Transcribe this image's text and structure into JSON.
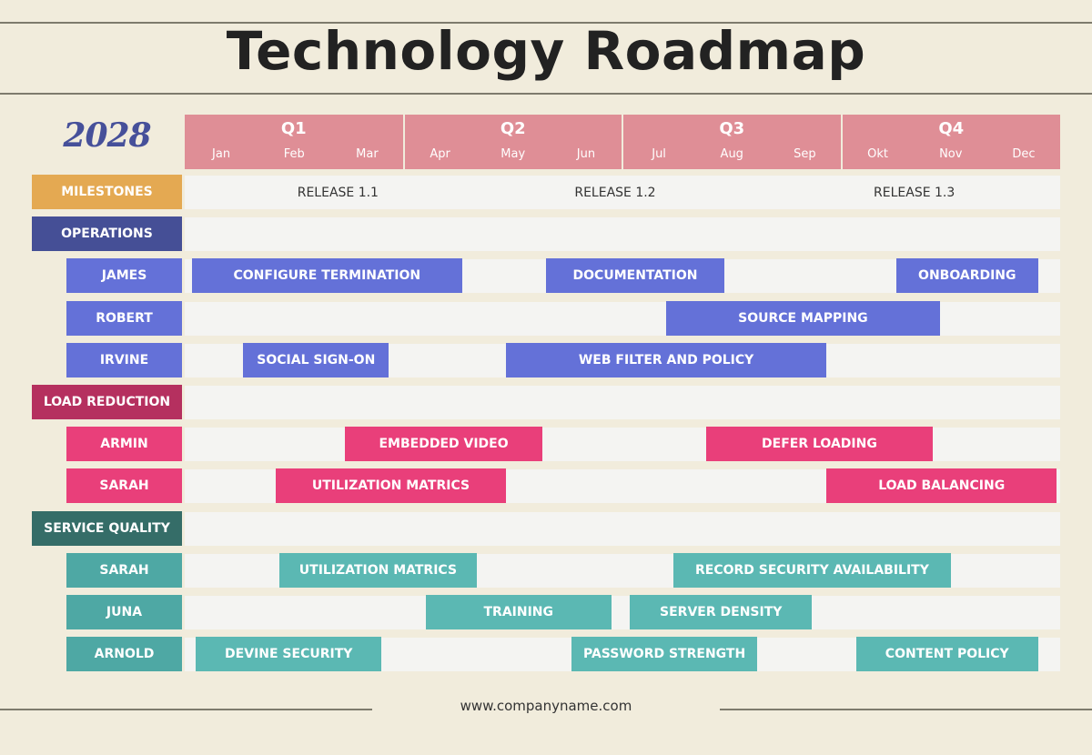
{
  "title": "Technology Roadmap",
  "footer": "www.companyname.com",
  "chart_data": {
    "type": "gantt",
    "title": "Technology Roadmap",
    "year": "2028",
    "quarters": [
      "Q1",
      "Q2",
      "Q3",
      "Q4"
    ],
    "months": [
      "Jan",
      "Feb",
      "Mar",
      "Apr",
      "May",
      "Jun",
      "Jul",
      "Aug",
      "Sep",
      "Okt",
      "Nov",
      "Dec"
    ],
    "milestones": {
      "label": "MILESTONES",
      "color": "#e4a952",
      "items": [
        {
          "label": "RELEASE 1.1",
          "month": 2.1
        },
        {
          "label": "RELEASE 1.2",
          "month": 5.9
        },
        {
          "label": "RELEASE 1.3",
          "month": 10.0
        }
      ]
    },
    "groups": [
      {
        "label": "OPERATIONS",
        "header_color": "#454f96",
        "bar_color": "#6471d8",
        "rows": [
          {
            "name": "JAMES",
            "tasks": [
              {
                "label": "CONFIGURE TERMINATION",
                "start": 0.1,
                "end": 3.8
              },
              {
                "label": "DOCUMENTATION",
                "start": 4.95,
                "end": 7.4
              },
              {
                "label": "ONBOARDING",
                "start": 9.75,
                "end": 11.7
              }
            ]
          },
          {
            "name": "ROBERT",
            "tasks": [
              {
                "label": "SOURCE MAPPING",
                "start": 6.6,
                "end": 10.35
              }
            ]
          },
          {
            "name": "IRVINE",
            "tasks": [
              {
                "label": "SOCIAL SIGN-ON",
                "start": 0.8,
                "end": 2.8
              },
              {
                "label": "WEB FILTER AND POLICY",
                "start": 4.4,
                "end": 8.8
              }
            ]
          }
        ]
      },
      {
        "label": "LOAD REDUCTION",
        "header_color": "#b5305f",
        "bar_color": "#e93f7a",
        "rows": [
          {
            "name": "ARMIN",
            "tasks": [
              {
                "label": "EMBEDDED VIDEO",
                "start": 2.2,
                "end": 4.9
              },
              {
                "label": "DEFER LOADING",
                "start": 7.15,
                "end": 10.25
              }
            ]
          },
          {
            "name": "SARAH",
            "tasks": [
              {
                "label": "UTILIZATION MATRICS",
                "start": 1.25,
                "end": 4.4
              },
              {
                "label": "LOAD BALANCING",
                "start": 8.8,
                "end": 11.95
              }
            ]
          }
        ]
      },
      {
        "label": "SERVICE QUALITY",
        "header_color": "#356d68",
        "bar_color": "#5bb8b3",
        "label_color": "#4ea8a4",
        "rows": [
          {
            "name": "SARAH",
            "tasks": [
              {
                "label": "UTILIZATION MATRICS",
                "start": 1.3,
                "end": 4.0
              },
              {
                "label": "RECORD SECURITY AVAILABILITY",
                "start": 6.7,
                "end": 10.5
              }
            ]
          },
          {
            "name": "JUNA",
            "tasks": [
              {
                "label": "TRAINING",
                "start": 3.3,
                "end": 5.85
              },
              {
                "label": "SERVER DENSITY",
                "start": 6.1,
                "end": 8.6
              }
            ]
          },
          {
            "name": "ARNOLD",
            "tasks": [
              {
                "label": "DEVINE SECURITY",
                "start": 0.15,
                "end": 2.7
              },
              {
                "label": "PASSWORD STRENGTH",
                "start": 5.3,
                "end": 7.85
              },
              {
                "label": "CONTENT POLICY",
                "start": 9.2,
                "end": 11.7
              }
            ]
          }
        ]
      }
    ],
    "header_color": "#df8e96"
  }
}
